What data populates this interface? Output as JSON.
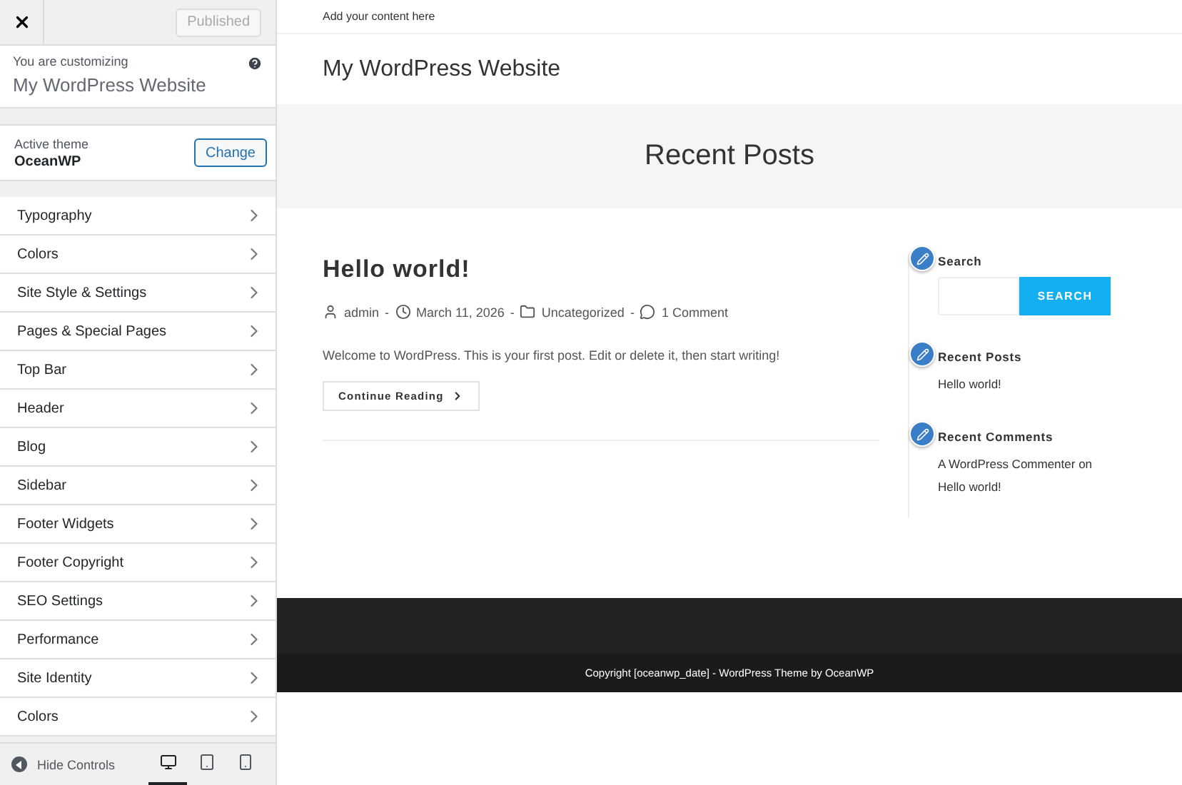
{
  "customizer": {
    "publish_button": "Published",
    "intro": "You are customizing",
    "site_name": "My WordPress Website",
    "active_theme_label": "Active theme",
    "theme_name": "OceanWP",
    "change_button": "Change",
    "sections": [
      "Typography",
      "Colors",
      "Site Style & Settings",
      "Pages & Special Pages",
      "Top Bar",
      "Header",
      "Blog",
      "Sidebar",
      "Footer Widgets",
      "Footer Copyright",
      "SEO Settings",
      "Performance",
      "Site Identity",
      "Colors"
    ],
    "hide_controls": "Hide Controls",
    "devices": [
      {
        "kind": "desktop",
        "selected": true
      },
      {
        "kind": "tablet",
        "selected": false
      },
      {
        "kind": "mobile",
        "selected": false
      }
    ]
  },
  "preview": {
    "top_bar": "Add your content here",
    "site_title": "My WordPress Website",
    "page_title": "Recent Posts",
    "post": {
      "separator": "-",
      "title": "Hello world!",
      "author": "admin",
      "date": "March 11, 2026",
      "category": "Uncategorized",
      "comments": "1 Comment",
      "excerpt": "Welcome to WordPress. This is your first post. Edit or delete it, then start writing!",
      "read_more": "Continue Reading"
    },
    "widgets": [
      {
        "kind": "search",
        "title": "Search",
        "button": "SEARCH"
      },
      {
        "kind": "links",
        "title": "Recent Posts",
        "lines": [
          "Hello world!"
        ]
      },
      {
        "kind": "links",
        "title": "Recent Comments",
        "lines": [
          "A WordPress Commenter on",
          "Hello world!"
        ]
      }
    ],
    "copyright": "Copyright [oceanwp_date] - WordPress Theme by OceanWP"
  }
}
